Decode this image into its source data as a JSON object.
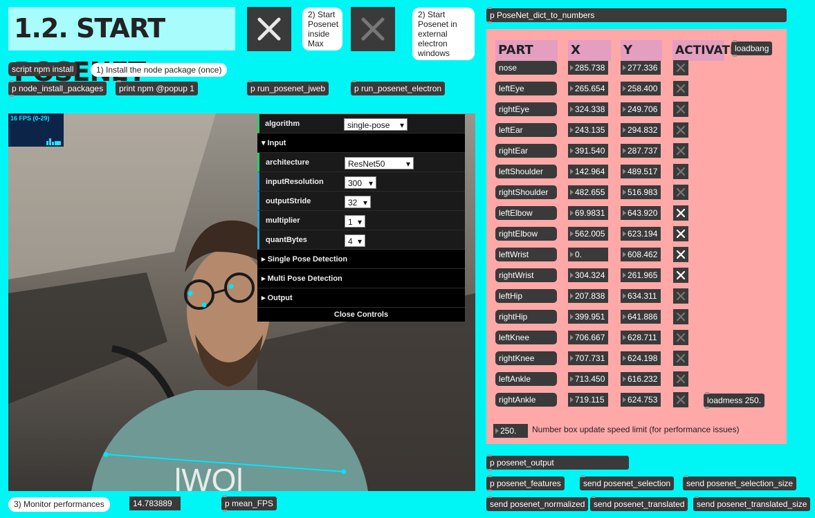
{
  "title": "1.2. START POSENET",
  "comments": {
    "start_inside": "2) Start Posenet inside Max",
    "start_external": "2) Start Posenet in external electron windows",
    "install": "1) Install the node package (once)",
    "monitor": "3) Monitor performances",
    "speed_limit": "Number box update speed limit (for performance issues)"
  },
  "objects": {
    "script_npm": "script npm install",
    "node_install": "p node_install_packages",
    "print_npm": "print npm @popup 1",
    "run_jweb": "p run_posenet_jweb",
    "run_electron": "p run_posenet_electron",
    "dict_to_numbers": "p PoseNet_dict_to_numbers",
    "loadbang": "loadbang",
    "loadmess": "loadmess 250.",
    "speed_value": "250.",
    "fps_value": "14.783889",
    "mean_fps": "p mean_FPS",
    "posenet_output": "p posenet_output",
    "posenet_features": "p posenet_features",
    "send_selection": "send posenet_selection",
    "send_selection_size": "send posenet_selection_size",
    "send_normalized": "send posenet_normalized",
    "send_translated": "send posenet_translated",
    "send_translated_size": "send posenet_translated_size"
  },
  "fps_overlay": "16 FPS (0-29)",
  "gui": {
    "algorithm_label": "algorithm",
    "algorithm_value": "single-pose",
    "input_folder": "Input",
    "architecture_label": "architecture",
    "architecture_value": "ResNet50",
    "inputResolution_label": "inputResolution",
    "inputResolution_value": "300",
    "outputStride_label": "outputStride",
    "outputStride_value": "32",
    "multiplier_label": "multiplier",
    "multiplier_value": "1",
    "quantBytes_label": "quantBytes",
    "quantBytes_value": "4",
    "single_pose": "Single Pose Detection",
    "multi_pose": "Multi Pose Detection",
    "output": "Output",
    "close": "Close Controls"
  },
  "table_headers": {
    "part": "PART",
    "x": "X",
    "y": "Y",
    "activate": "ACTIVATE"
  },
  "parts": [
    {
      "name": "nose",
      "x": "285.738",
      "y": "277.336",
      "active": false
    },
    {
      "name": "leftEye",
      "x": "265.654",
      "y": "258.400",
      "active": false
    },
    {
      "name": "rightEye",
      "x": "324.338",
      "y": "249.706",
      "active": false
    },
    {
      "name": "leftEar",
      "x": "243.135",
      "y": "294.832",
      "active": false
    },
    {
      "name": "rightEar",
      "x": "391.540",
      "y": "287.737",
      "active": false
    },
    {
      "name": "leftShoulder",
      "x": "142.964",
      "y": "489.517",
      "active": false
    },
    {
      "name": "rightShoulder",
      "x": "482.655",
      "y": "516.983",
      "active": false
    },
    {
      "name": "leftElbow",
      "x": "69.9831",
      "y": "643.920",
      "active": true
    },
    {
      "name": "rightElbow",
      "x": "562.005",
      "y": "623.194",
      "active": true
    },
    {
      "name": "leftWrist",
      "x": "0.",
      "y": "608.462",
      "active": true
    },
    {
      "name": "rightWrist",
      "x": "304.324",
      "y": "261.965",
      "active": true
    },
    {
      "name": "leftHip",
      "x": "207.838",
      "y": "634.311",
      "active": false
    },
    {
      "name": "rightHip",
      "x": "399.951",
      "y": "641.886",
      "active": false
    },
    {
      "name": "leftKnee",
      "x": "706.667",
      "y": "628.711",
      "active": false
    },
    {
      "name": "rightKnee",
      "x": "707.731",
      "y": "624.198",
      "active": false
    },
    {
      "name": "leftAnkle",
      "x": "713.450",
      "y": "616.232",
      "active": false
    },
    {
      "name": "rightAnkle",
      "x": "719.115",
      "y": "624.753",
      "active": false
    }
  ],
  "colors": {
    "background": "#00f5f5",
    "panel": "#ffa8a8",
    "keypoint": "#00e5ff",
    "object": "#3a3a3a"
  }
}
